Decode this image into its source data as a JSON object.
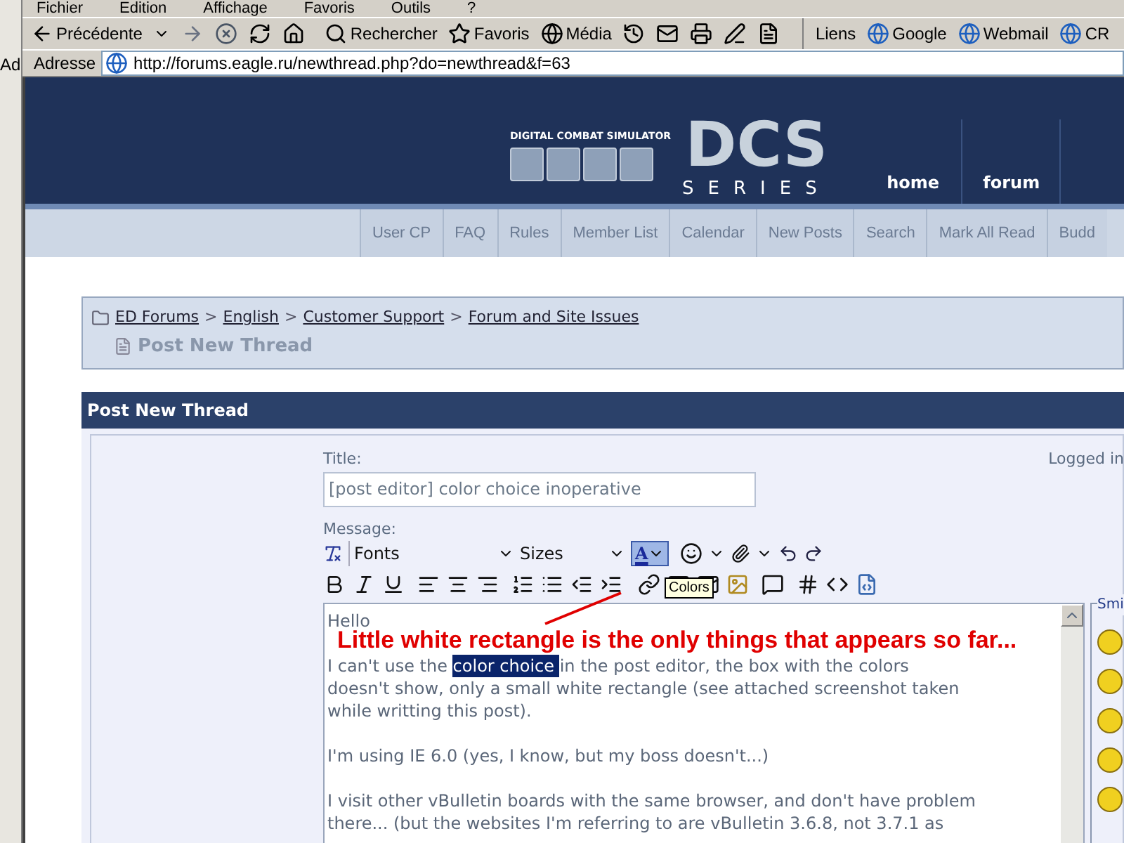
{
  "menu_bar": [
    "Fichier",
    "Edition",
    "Affichage",
    "Favoris",
    "Outils",
    "?"
  ],
  "side_window": {
    "label": "Ad"
  },
  "toolbar": {
    "back": "Précédente",
    "search": "Rechercher",
    "favorites": "Favoris",
    "media": "Média",
    "links_label": "Liens",
    "links": [
      "Google",
      "Webmail",
      "CR"
    ]
  },
  "address_bar": {
    "label": "Adresse",
    "url": "http://forums.eagle.ru/newthread.php?do=newthread&f=63"
  },
  "site_header": {
    "tagline": "DIGITAL COMBAT SIMULATOR",
    "logo_text": "DCS",
    "logo_subtitle": "SERIES",
    "tabs": [
      "home",
      "forum"
    ]
  },
  "nav": [
    "User CP",
    "FAQ",
    "Rules",
    "Member List",
    "Calendar",
    "New Posts",
    "Search",
    "Mark All Read",
    "Budd"
  ],
  "breadcrumb": {
    "separator": ">",
    "links": [
      "ED Forums",
      "English",
      "Customer Support",
      "Forum and Site Issues"
    ],
    "current": "Post New Thread"
  },
  "panel_title": "Post New Thread",
  "form": {
    "title_label": "Title:",
    "title_value": "[post editor] color choice inoperative",
    "logged_in": "Logged in",
    "message_label": "Message:",
    "font_select": "Fonts",
    "size_select": "Sizes",
    "color_button_label": "A",
    "color_button_selected": true,
    "tooltip": "Colors",
    "smilies_label": "Smi"
  },
  "editor": {
    "paragraphs": [
      [
        [
          {
            "text": "Hello",
            "selected": false
          }
        ]
      ],
      [
        [
          {
            "text": "I can't use the ",
            "selected": false
          },
          {
            "text": "color choice ",
            "selected": true
          },
          {
            "text": "in the post editor, the box with the colors",
            "selected": false
          }
        ],
        [
          {
            "text": "doesn't show, only a small white rectangle (see attached screenshot taken",
            "selected": false
          }
        ],
        [
          {
            "text": "while writting this post).",
            "selected": false
          }
        ]
      ],
      [
        [
          {
            "text": "I'm using IE 6.0 (yes, I know, but my boss doesn't...)",
            "selected": false
          }
        ]
      ],
      [
        [
          {
            "text": "I visit other vBulletin boards with the same browser, and don't have problem",
            "selected": false
          }
        ],
        [
          {
            "text": "there... (but the websites I'm referring to are vBulletin 3.6.8, not 3.7.1 as",
            "selected": false
          }
        ]
      ]
    ]
  },
  "annotation": "Little white rectangle is the only things that appears so far..."
}
